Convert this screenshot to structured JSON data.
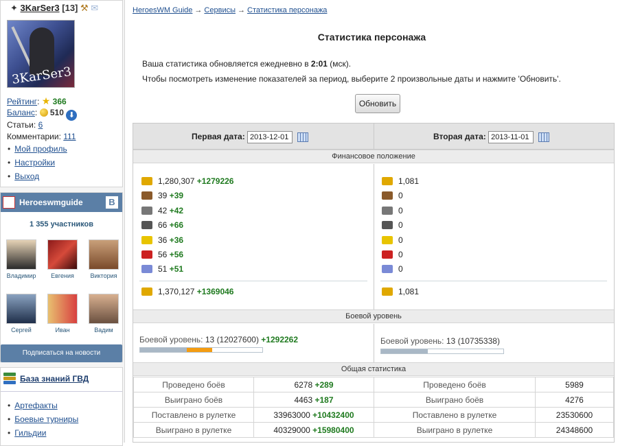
{
  "sidebar": {
    "user": {
      "name": "3KarSer3",
      "level": "[13]",
      "rating_label": "Рейтинг",
      "rating_value": "366",
      "balance_label": "Баланс",
      "balance_value": "510",
      "articles_label": "Статьи:",
      "articles_value": "6",
      "comments_label": "Комментарии:",
      "comments_value": "111",
      "links": [
        "Мой профиль",
        "Настройки",
        "Выход"
      ]
    },
    "vk": {
      "title": "Heroeswmguide",
      "badge": "B",
      "member_count": "1 355 участников",
      "members": [
        "Владимир",
        "Евгения",
        "Виктория",
        "Сергей",
        "Иван",
        "Вадим"
      ],
      "subscribe_label": "Подписаться на новости"
    },
    "kb": {
      "title": "База знаний ГВД",
      "links": [
        "Артефакты",
        "Боевые турниры",
        "Гильдии"
      ]
    }
  },
  "main": {
    "breadcrumb": [
      "HeroesWM Guide",
      "Сервисы",
      "Статистика персонажа"
    ],
    "breadcrumb_sep": "→",
    "title": "Статистика персонажа",
    "info1_pre": "Ваша статистика обновляется ежедневно в ",
    "info1_time": "2:01",
    "info1_post": " (мск).",
    "info2": "Чтобы посмотреть изменение показателей за период, выберите 2 произвольные даты и нажмите 'Обновить'.",
    "update_button": "Обновить",
    "first_date_label": "Первая дата:",
    "first_date": "2013-12-01",
    "second_date_label": "Вторая дата:",
    "second_date": "2013-11-01",
    "finance_head": "Финансовое положение",
    "resources_left": [
      {
        "value": "1,280,307",
        "delta": "+1279226",
        "icon": "gold-icon",
        "color": "#e0a800"
      },
      {
        "value": "39",
        "delta": "+39",
        "icon": "wood-icon",
        "color": "#8a5a2b"
      },
      {
        "value": "42",
        "delta": "+42",
        "icon": "ore-icon",
        "color": "#777777"
      },
      {
        "value": "66",
        "delta": "+66",
        "icon": "mercury-icon",
        "color": "#555555"
      },
      {
        "value": "36",
        "delta": "+36",
        "icon": "sulfur-icon",
        "color": "#e8c400"
      },
      {
        "value": "56",
        "delta": "+56",
        "icon": "crystal-icon",
        "color": "#cc2222"
      },
      {
        "value": "51",
        "delta": "+51",
        "icon": "gems-icon",
        "color": "#7a8ad6"
      }
    ],
    "resources_right": [
      {
        "value": "1,081",
        "icon": "gold-icon",
        "color": "#e0a800"
      },
      {
        "value": "0",
        "icon": "wood-icon",
        "color": "#8a5a2b"
      },
      {
        "value": "0",
        "icon": "ore-icon",
        "color": "#777777"
      },
      {
        "value": "0",
        "icon": "mercury-icon",
        "color": "#555555"
      },
      {
        "value": "0",
        "icon": "sulfur-icon",
        "color": "#e8c400"
      },
      {
        "value": "0",
        "icon": "crystal-icon",
        "color": "#cc2222"
      },
      {
        "value": "0",
        "icon": "gems-icon",
        "color": "#7a8ad6"
      }
    ],
    "total_left": {
      "value": "1,370,127",
      "delta": "+1369046"
    },
    "total_right": {
      "value": "1,081"
    },
    "combat_head": "Боевой уровень",
    "combat_label": "Боевой уровень:",
    "combat_left": {
      "level": "13",
      "exp": "(12027600)",
      "delta": "+1292262",
      "base_fraction": 0.38,
      "gain_fraction": 0.21
    },
    "combat_right": {
      "level": "13",
      "exp": "(10735338)",
      "base_fraction": 0.38
    },
    "general_head": "Общая статистика",
    "general_rows": [
      {
        "label": "Проведено боёв",
        "left": "6278",
        "delta": "+289",
        "right": "5989"
      },
      {
        "label": "Выиграно боёв",
        "left": "4463",
        "delta": "+187",
        "right": "4276"
      },
      {
        "label": "Поставлено в рулетке",
        "left": "33963000",
        "delta": "+10432400",
        "right": "23530600"
      },
      {
        "label": "Выиграно в рулетке",
        "left": "40329000",
        "delta": "+15980400",
        "right": "24348600"
      }
    ]
  }
}
